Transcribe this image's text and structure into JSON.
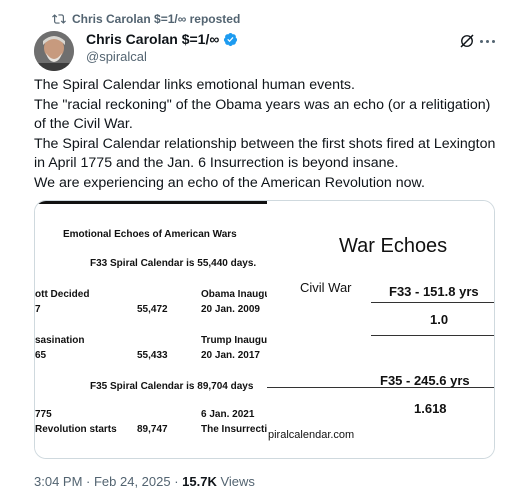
{
  "repost": {
    "text": "Chris Carolan $=1/∞ reposted"
  },
  "author": {
    "name": "Chris Carolan $=1/∞",
    "handle": "@spiralcal"
  },
  "tweet": {
    "lines": [
      "The Spiral Calendar links emotional human events.",
      "The \"racial reckoning\" of the Obama years was an echo (or a relitigation) of the Civil War.",
      "The Spiral Calendar relationship between the first shots fired at Lexington in April 1775 and the Jan. 6 Insurrection is beyond insane.",
      "We are experiencing an echo of the American Revolution now."
    ]
  },
  "image_left": {
    "title": "Emotional Echoes of American Wars",
    "f33_line": "F33 Spiral Calendar is 55,440 days.",
    "row1_left_a": "ott Decided",
    "row1_left_b": "7",
    "row1_value": "55,472",
    "row1_right_a": "Obama Inaugu",
    "row1_right_b": "20 Jan. 2009",
    "row2_left_a": "sasination",
    "row2_left_b": "65",
    "row2_value": "55,433",
    "row2_right_a": "Trump Inaugu",
    "row2_right_b": "20 Jan. 2017",
    "f35_line": "F35 Spiral Calendar is 89,704 days",
    "row3_left_a": "775",
    "row3_left_b": "Revolution starts",
    "row3_value": "89,747",
    "row3_right_a": "6 Jan. 2021",
    "row3_right_b": "The Insurrecti"
  },
  "image_right": {
    "title": "War  Echoes",
    "civil_war": "Civil  War",
    "f33": "F33  -  151.8  yrs",
    "ratio1": "1.0",
    "f35": "F35  -  245.6  yrs",
    "ratio2": "1.618",
    "url": "piralcalendar.com"
  },
  "footer": {
    "time": "3:04 PM · Feb 24, 2025 · ",
    "views_count": "15.7K",
    "views_label": " Views"
  },
  "colors": {
    "verified": "#1d9bf0",
    "muted": "#536471"
  }
}
